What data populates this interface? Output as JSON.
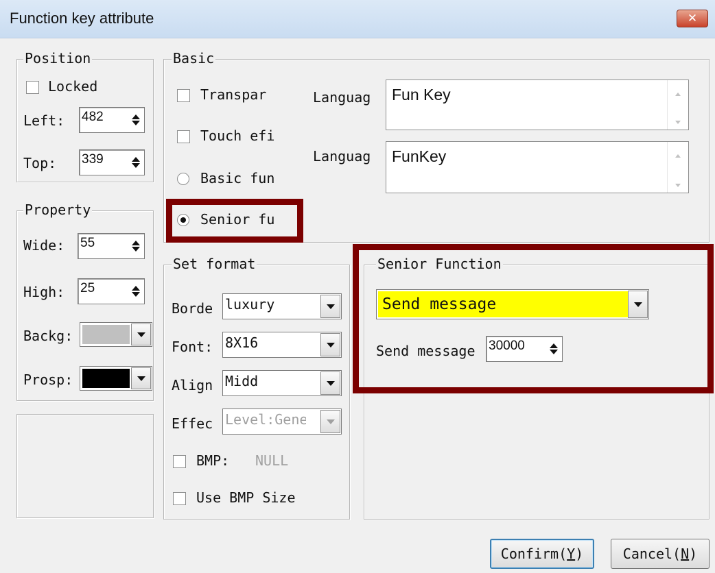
{
  "window": {
    "title": "Function key attribute",
    "close_label": "✕"
  },
  "position": {
    "legend": "Position",
    "locked_label": "Locked",
    "locked_checked": false,
    "left_label": "Left:",
    "left_value": "482",
    "top_label": "Top:",
    "top_value": "339"
  },
  "property": {
    "legend": "Property",
    "wide_label": "Wide:",
    "wide_value": "55",
    "high_label": "High:",
    "high_value": "25",
    "backg_label": "Backg:",
    "backg_color": "#c0c0c0",
    "prosp_label": "Prosp:",
    "prosp_color": "#000000"
  },
  "basic": {
    "legend": "Basic",
    "transpar_label": "Transpar",
    "touch_effect_label": "Touch efi",
    "basic_fun_label": "Basic fun",
    "senior_fu_label": "Senior fu",
    "language1_label": "Languag",
    "language1_value": "Fun Key",
    "language2_label": "Languag",
    "language2_value": "FunKey"
  },
  "set_format": {
    "legend": "Set format",
    "border_label": "Borde",
    "border_value": "luxury",
    "font_label": "Font:",
    "font_value": "8X16",
    "align_label": "Align",
    "align_value": "Midd",
    "effect_label": "Effec",
    "effect_value": "Level:Gene",
    "bmp_label": "BMP:",
    "bmp_value": "NULL",
    "use_bmp_size_label": "Use BMP Size"
  },
  "senior_function": {
    "legend": "Senior Function",
    "selected": "Send message",
    "highlight_color": "#ffff00",
    "send_message_label": "Send message",
    "send_message_value": "30000"
  },
  "buttons": {
    "confirm_text": "Confirm(",
    "confirm_key": "Y",
    "confirm_close": ")",
    "cancel_text": "Cancel(",
    "cancel_key": "N",
    "cancel_close": ")"
  },
  "colors": {
    "highlight_border": "#7b0000",
    "title_bar": "#c9dcf1"
  }
}
